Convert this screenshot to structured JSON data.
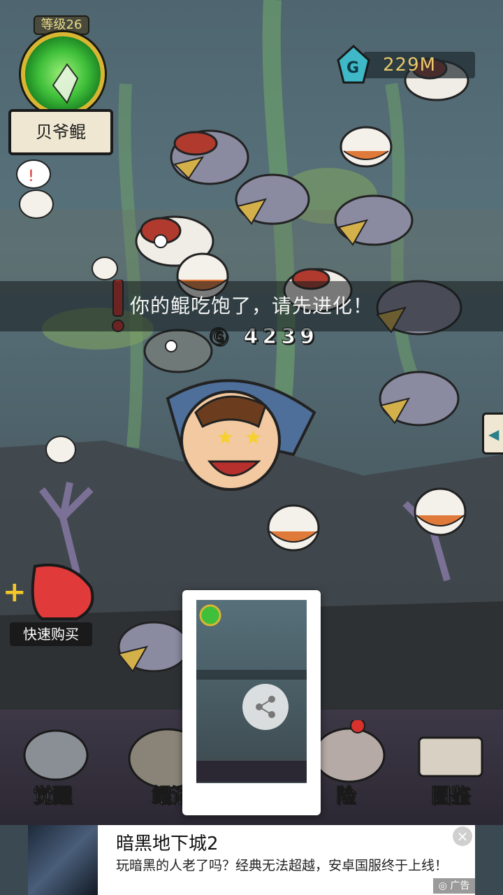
{
  "player": {
    "level": "等级26",
    "name": "贝爷鲲"
  },
  "currency": {
    "value": "229M",
    "icon": "g-crystal-icon"
  },
  "toast": "你的鲲吃饱了，请先进化！",
  "combo": "4239",
  "quick_buy": {
    "label": "快速购买"
  },
  "nav": [
    {
      "label": "觉醒",
      "icon": "fish-bust-icon"
    },
    {
      "label": "鲲池",
      "icon": "fish-bowl-icon"
    },
    {
      "label": "险",
      "icon": "skull-icon"
    },
    {
      "label": "图鉴",
      "icon": "scroll-icon"
    }
  ],
  "share": {
    "icon": "share-icon"
  },
  "ad": {
    "title": "暗黑地下城2",
    "description": "玩暗黑的人老了吗？经典无法超越，安卓国服终于上线！",
    "tag": "广告",
    "close": "×"
  }
}
